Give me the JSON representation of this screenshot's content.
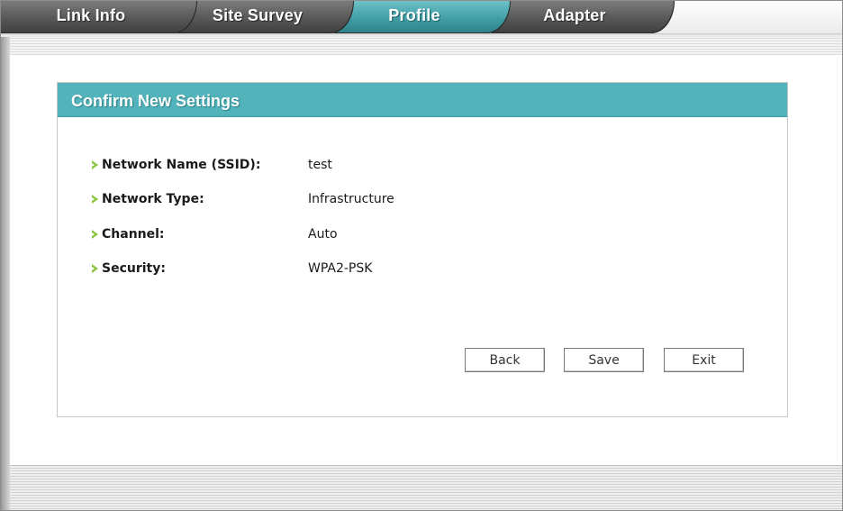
{
  "tabs": [
    {
      "label": "Link Info",
      "active": false
    },
    {
      "label": "Site Survey",
      "active": false
    },
    {
      "label": "Profile",
      "active": true
    },
    {
      "label": "Adapter",
      "active": false
    }
  ],
  "panel": {
    "title": "Confirm New Settings",
    "rows": [
      {
        "label": "Network Name (SSID):",
        "value": "test"
      },
      {
        "label": "Network Type:",
        "value": "Infrastructure"
      },
      {
        "label": "Channel:",
        "value": "Auto"
      },
      {
        "label": "Security:",
        "value": "WPA2-PSK"
      }
    ]
  },
  "buttons": {
    "back": "Back",
    "save": "Save",
    "exit": "Exit"
  },
  "colors": {
    "accent": "#52b3ba",
    "bullet": "#8bc53f",
    "tab_inactive": "#575757"
  }
}
